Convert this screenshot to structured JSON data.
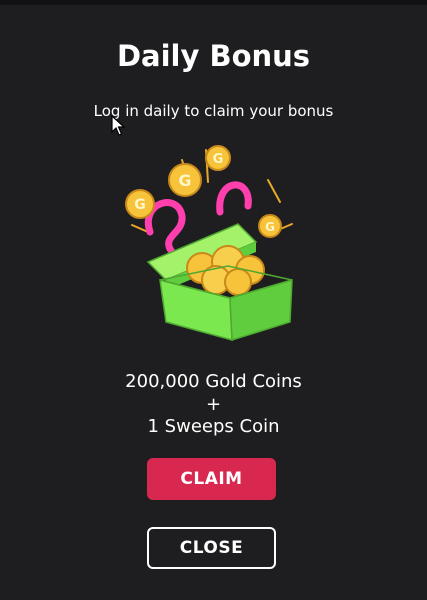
{
  "dialog": {
    "title": "Daily Bonus",
    "subtitle": "Log in daily to claim your bonus",
    "reward": {
      "gold": "200,000 Gold Coins",
      "plus": "+",
      "sweeps": "1 Sweeps Coin"
    },
    "claim_label": "CLAIM",
    "close_label": "CLOSE",
    "illustration": "green-gift-box-with-gold-coins",
    "coin_letter": "G"
  },
  "colors": {
    "background": "#1e1e20",
    "claim_button": "#d8284f",
    "box_green": "#7be84f",
    "coin_gold": "#f6c33b",
    "ribbon": "#ff3fae"
  }
}
